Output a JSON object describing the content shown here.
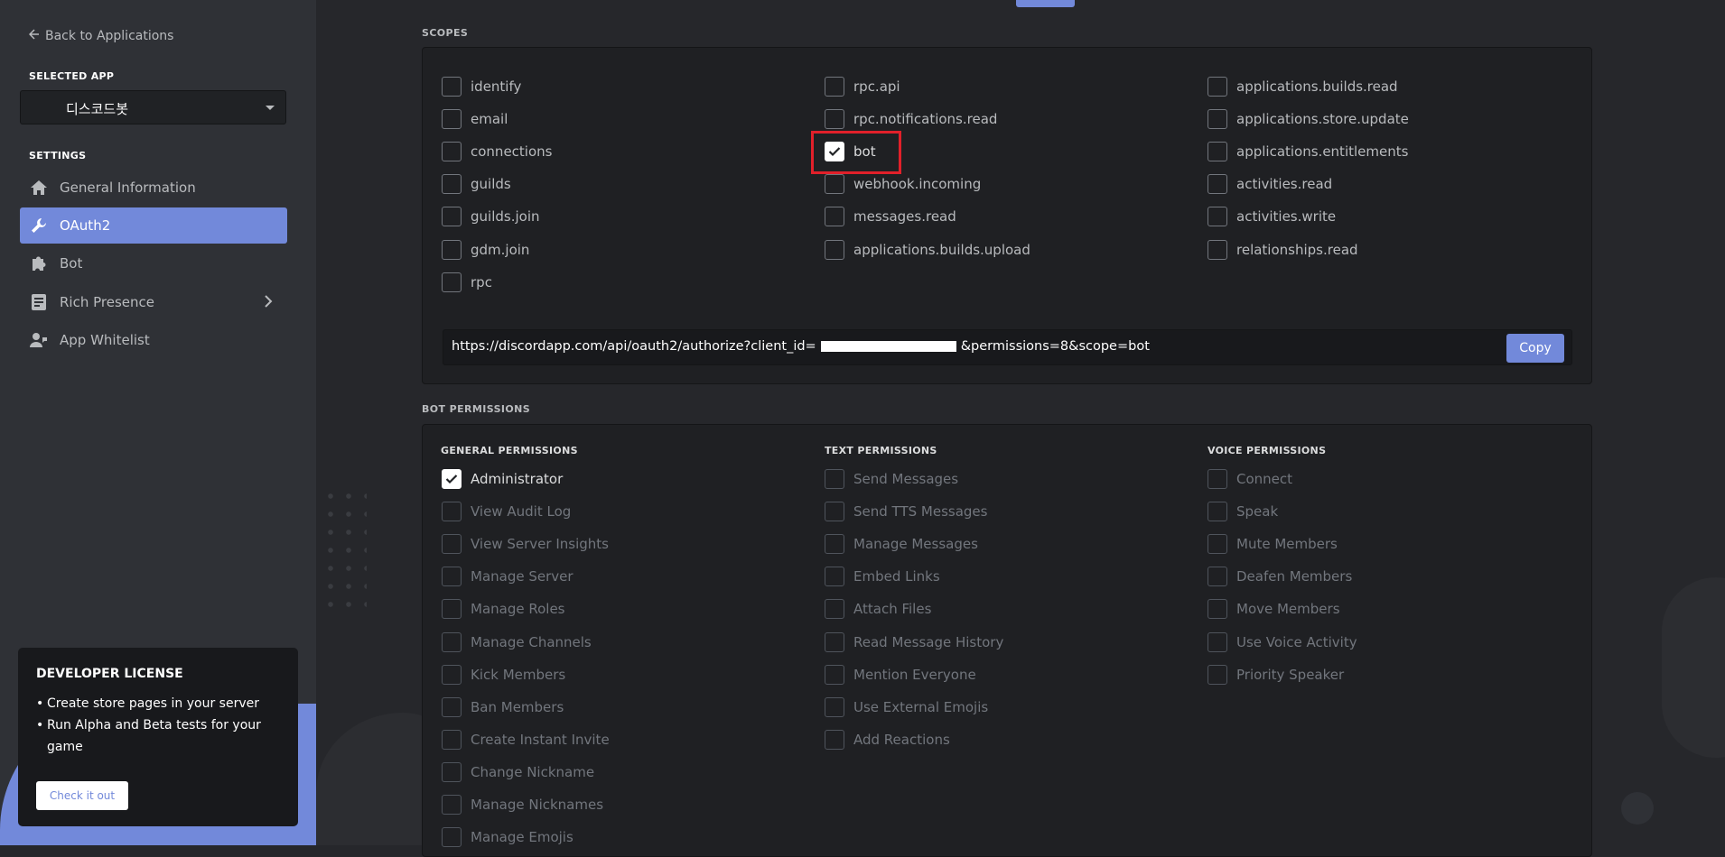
{
  "sidebar": {
    "back_label": "Back to Applications",
    "selected_app_label": "SELECTED APP",
    "selected_app_name": "디스코드봇",
    "settings_label": "SETTINGS",
    "nav": [
      {
        "label": "General Information",
        "icon": "home-icon"
      },
      {
        "label": "OAuth2",
        "icon": "wrench-icon",
        "active": true
      },
      {
        "label": "Bot",
        "icon": "puzzle-icon"
      },
      {
        "label": "Rich Presence",
        "icon": "document-icon"
      },
      {
        "label": "App Whitelist",
        "icon": "user-phone-icon"
      }
    ],
    "dev_license": {
      "title": "DEVELOPER LICENSE",
      "bullets": [
        "Create store pages in your server",
        "Run Alpha and Beta tests for your game"
      ],
      "button": "Check it out"
    }
  },
  "scopes": {
    "label": "SCOPES",
    "col1": [
      {
        "label": "identify",
        "checked": false
      },
      {
        "label": "email",
        "checked": false
      },
      {
        "label": "connections",
        "checked": false
      },
      {
        "label": "guilds",
        "checked": false
      },
      {
        "label": "guilds.join",
        "checked": false
      },
      {
        "label": "gdm.join",
        "checked": false
      },
      {
        "label": "rpc",
        "checked": false
      }
    ],
    "col2": [
      {
        "label": "rpc.api",
        "checked": false
      },
      {
        "label": "rpc.notifications.read",
        "checked": false
      },
      {
        "label": "bot",
        "checked": true
      },
      {
        "label": "webhook.incoming",
        "checked": false
      },
      {
        "label": "messages.read",
        "checked": false
      },
      {
        "label": "applications.builds.upload",
        "checked": false
      }
    ],
    "col3": [
      {
        "label": "applications.builds.read",
        "checked": false
      },
      {
        "label": "applications.store.update",
        "checked": false
      },
      {
        "label": "applications.entitlements",
        "checked": false
      },
      {
        "label": "activities.read",
        "checked": false
      },
      {
        "label": "activities.write",
        "checked": false
      },
      {
        "label": "relationships.read",
        "checked": false
      }
    ],
    "url_prefix": "https://discordapp.com/api/oauth2/authorize?client_id=",
    "url_suffix": "&permissions=8&scope=bot",
    "copy_label": "Copy"
  },
  "bot_permissions": {
    "label": "BOT PERMISSIONS",
    "general": {
      "title": "GENERAL PERMISSIONS",
      "items": [
        {
          "label": "Administrator",
          "checked": true,
          "disabled": false
        },
        {
          "label": "View Audit Log",
          "checked": false,
          "disabled": true
        },
        {
          "label": "View Server Insights",
          "checked": false,
          "disabled": true
        },
        {
          "label": "Manage Server",
          "checked": false,
          "disabled": true
        },
        {
          "label": "Manage Roles",
          "checked": false,
          "disabled": true
        },
        {
          "label": "Manage Channels",
          "checked": false,
          "disabled": true
        },
        {
          "label": "Kick Members",
          "checked": false,
          "disabled": true
        },
        {
          "label": "Ban Members",
          "checked": false,
          "disabled": true
        },
        {
          "label": "Create Instant Invite",
          "checked": false,
          "disabled": true
        },
        {
          "label": "Change Nickname",
          "checked": false,
          "disabled": true
        },
        {
          "label": "Manage Nicknames",
          "checked": false,
          "disabled": true
        },
        {
          "label": "Manage Emojis",
          "checked": false,
          "disabled": true
        }
      ]
    },
    "text": {
      "title": "TEXT PERMISSIONS",
      "items": [
        {
          "label": "Send Messages",
          "checked": false,
          "disabled": true
        },
        {
          "label": "Send TTS Messages",
          "checked": false,
          "disabled": true
        },
        {
          "label": "Manage Messages",
          "checked": false,
          "disabled": true
        },
        {
          "label": "Embed Links",
          "checked": false,
          "disabled": true
        },
        {
          "label": "Attach Files",
          "checked": false,
          "disabled": true
        },
        {
          "label": "Read Message History",
          "checked": false,
          "disabled": true
        },
        {
          "label": "Mention Everyone",
          "checked": false,
          "disabled": true
        },
        {
          "label": "Use External Emojis",
          "checked": false,
          "disabled": true
        },
        {
          "label": "Add Reactions",
          "checked": false,
          "disabled": true
        }
      ]
    },
    "voice": {
      "title": "VOICE PERMISSIONS",
      "items": [
        {
          "label": "Connect",
          "checked": false,
          "disabled": true
        },
        {
          "label": "Speak",
          "checked": false,
          "disabled": true
        },
        {
          "label": "Mute Members",
          "checked": false,
          "disabled": true
        },
        {
          "label": "Deafen Members",
          "checked": false,
          "disabled": true
        },
        {
          "label": "Move Members",
          "checked": false,
          "disabled": true
        },
        {
          "label": "Use Voice Activity",
          "checked": false,
          "disabled": true
        },
        {
          "label": "Priority Speaker",
          "checked": false,
          "disabled": true
        }
      ]
    }
  },
  "colors": {
    "accent": "#7289da",
    "highlight": "#e1202a",
    "sidebar_bg": "#2f3136",
    "main_bg": "#26272b"
  }
}
